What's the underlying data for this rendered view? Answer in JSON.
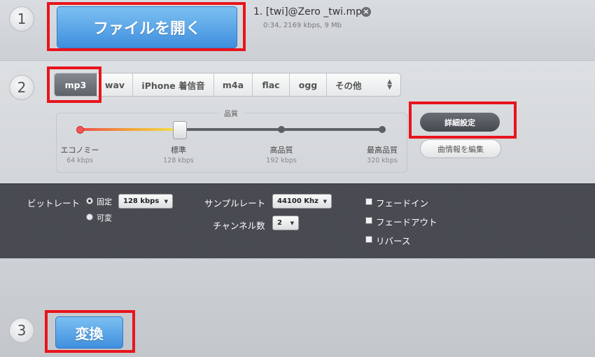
{
  "steps": [
    "1",
    "2",
    "3"
  ],
  "open_button": {
    "label": "ファイルを開く"
  },
  "file": {
    "name": "1. [twi]@Zero _twi.mp4",
    "meta": "0:34, 2169 kbps, 9 Mb",
    "remove_icon": "close-circle-icon"
  },
  "formats": [
    {
      "label": "mp3",
      "active": true
    },
    {
      "label": "wav"
    },
    {
      "label": "iPhone 着信音"
    },
    {
      "label": "m4a"
    },
    {
      "label": "flac"
    },
    {
      "label": "ogg"
    },
    {
      "label": "その他"
    }
  ],
  "quality": {
    "title": "品質",
    "selected_index": 1,
    "levels": [
      {
        "label": "エコノミー",
        "kbps": "64 kbps"
      },
      {
        "label": "標準",
        "kbps": "128 kbps"
      },
      {
        "label": "高品質",
        "kbps": "192 kbps"
      },
      {
        "label": "最高品質",
        "kbps": "320 kbps"
      }
    ]
  },
  "side_buttons": {
    "advanced": "詳細設定",
    "edit_info": "曲情報を編集"
  },
  "settings": {
    "bitrate_label": "ビットレート",
    "bitrate_modes": [
      {
        "label": "固定",
        "checked": true
      },
      {
        "label": "可変",
        "checked": false
      }
    ],
    "bitrate_value": "128 kbps",
    "samplerate_label": "サンプルレート",
    "samplerate_value": "44100 Khz",
    "channels_label": "チャンネル数",
    "channels_value": "2",
    "options": [
      {
        "label": "フェードイン"
      },
      {
        "label": "フェードアウト"
      },
      {
        "label": "リバース"
      }
    ]
  },
  "convert_button": {
    "label": "変換"
  },
  "colors": {
    "highlight": "#e8141c",
    "accent_blue": "#3f8fde",
    "dark_panel": "#4a4d53"
  }
}
